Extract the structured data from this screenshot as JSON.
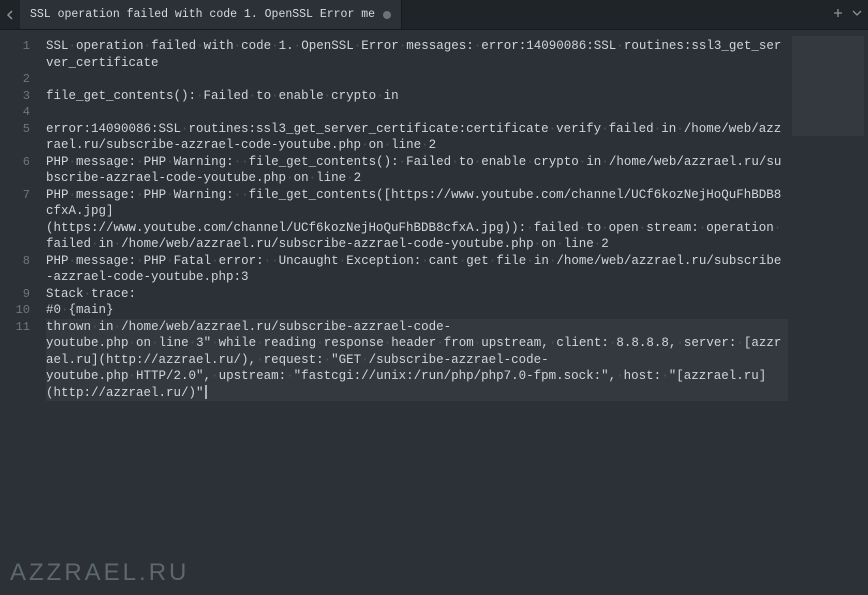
{
  "tab": {
    "title": "SSL operation failed with code 1. OpenSSL Error me",
    "dirty": true
  },
  "watermark": "AZZRAEL.RU",
  "lines": [
    {
      "num": "1",
      "text": "SSL·operation·failed·with·code·1.·OpenSSL·Error·messages:·error:14090086:SSL·routines:ssl3_get_server_certificate"
    },
    {
      "num": "2",
      "text": ""
    },
    {
      "num": "3",
      "text": "file_get_contents():·Failed·to·enable·crypto·in"
    },
    {
      "num": "4",
      "text": ""
    },
    {
      "num": "5",
      "text": "error:14090086:SSL·routines:ssl3_get_server_certificate:certificate·verify·failed·in·/home/web/azzrael.ru/subscribe-azzrael-code-youtube.php·on·line·2"
    },
    {
      "num": "6",
      "text": "PHP·message:·PHP·Warning:··file_get_contents():·Failed·to·enable·crypto·in·/home/web/azzrael.ru/subscribe-azzrael-code-youtube.php·on·line·2"
    },
    {
      "num": "7",
      "text": "PHP·message:·PHP·Warning:··file_get_contents([https://www.youtube.com/channel/UCf6kozNejHoQuFhBDB8cfxA.jpg](https://www.youtube.com/channel/UCf6kozNejHoQuFhBDB8cfxA.jpg)):·failed·to·open·stream:·operation·failed·in·/home/web/azzrael.ru/subscribe-azzrael-code-youtube.php·on·line·2"
    },
    {
      "num": "8",
      "text": "PHP·message:·PHP·Fatal·error:··Uncaught·Exception:·cant·get·file·in·/home/web/azzrael.ru/subscribe-azzrael-code-youtube.php:3"
    },
    {
      "num": "9",
      "text": "Stack·trace:"
    },
    {
      "num": "10",
      "text": "#0·{main}"
    },
    {
      "num": "11",
      "text": "thrown·in·/home/web/azzrael.ru/subscribe-azzrael-code-youtube.php·on·line·3\"·while·reading·response·header·from·upstream,·client:·8.8.8.8,·server:·[azzrael.ru](http://azzrael.ru/),·request:·\"GET·/subscribe-azzrael-code-youtube.php·HTTP/2.0\",·upstream:·\"fastcgi://unix:/run/php/php7.0-fpm.sock:\",·host:·\"[azzrael.ru](http://azzrael.ru/)\"",
      "highlighted": true,
      "cursor": true
    }
  ]
}
